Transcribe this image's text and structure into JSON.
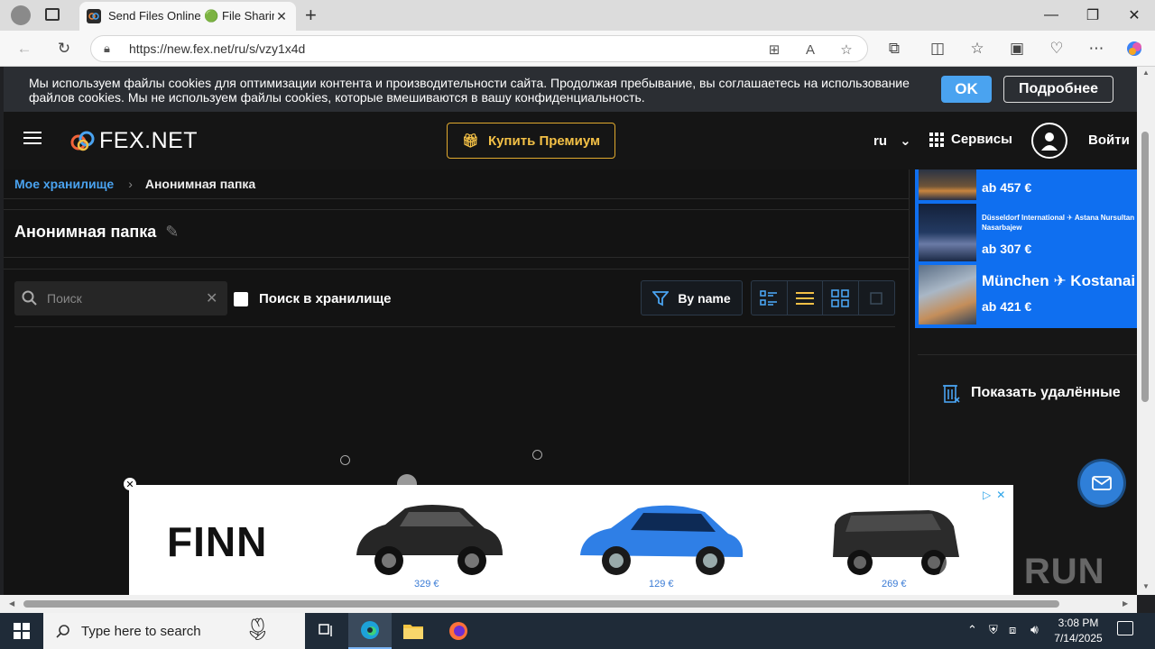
{
  "browser": {
    "tab_title": "Send Files Online 🟢 File Sharing",
    "url": "https://new.fex.net/ru/s/vzy1x4d"
  },
  "cookie": {
    "text": "Мы используем файлы cookies для оптимизации контента и производительности сайта. Продолжая пребывание, вы соглашаетесь на использование файлов cookies. Мы не используем файлы cookies, которые вмешиваются в вашу конфиденциальность.",
    "ok_label": "OK",
    "more_label": "Подробнее"
  },
  "header": {
    "logo_text": "FEX.NET",
    "premium_label": "Купить Премиум",
    "lang": "ru",
    "services_label": "Сервисы",
    "login_label": "Войти"
  },
  "breadcrumb": {
    "root": "Мое хранилище",
    "current": "Анонимная папка"
  },
  "folder": {
    "title": "Анонимная папка"
  },
  "toolbar": {
    "search_placeholder": "Поиск",
    "search_scope_label": "Поиск в хранилище",
    "sort_label": "By name"
  },
  "side_ad": {
    "rows": [
      {
        "route": "",
        "price": "ab 457 €"
      },
      {
        "route": "Düsseldorf International ✈ Astana Nursultan Nasarbajew",
        "price": "ab 307 €"
      },
      {
        "route": "München ✈ Kostanai",
        "price": "ab 421 €"
      }
    ]
  },
  "sidebar": {
    "show_deleted_label": "Показать удалённые"
  },
  "banner": {
    "brand": "FINN",
    "prices": [
      "329 €",
      "129 €",
      "269 €"
    ]
  },
  "taskbar": {
    "search_placeholder": "Type here to search",
    "time": "3:08 PM",
    "date": "7/14/2025"
  },
  "watermark": "ANY RUN",
  "colors": {
    "accent_blue": "#4aa3f0",
    "premium_gold": "#f3c046",
    "ad_blue": "#0f6ff0"
  }
}
